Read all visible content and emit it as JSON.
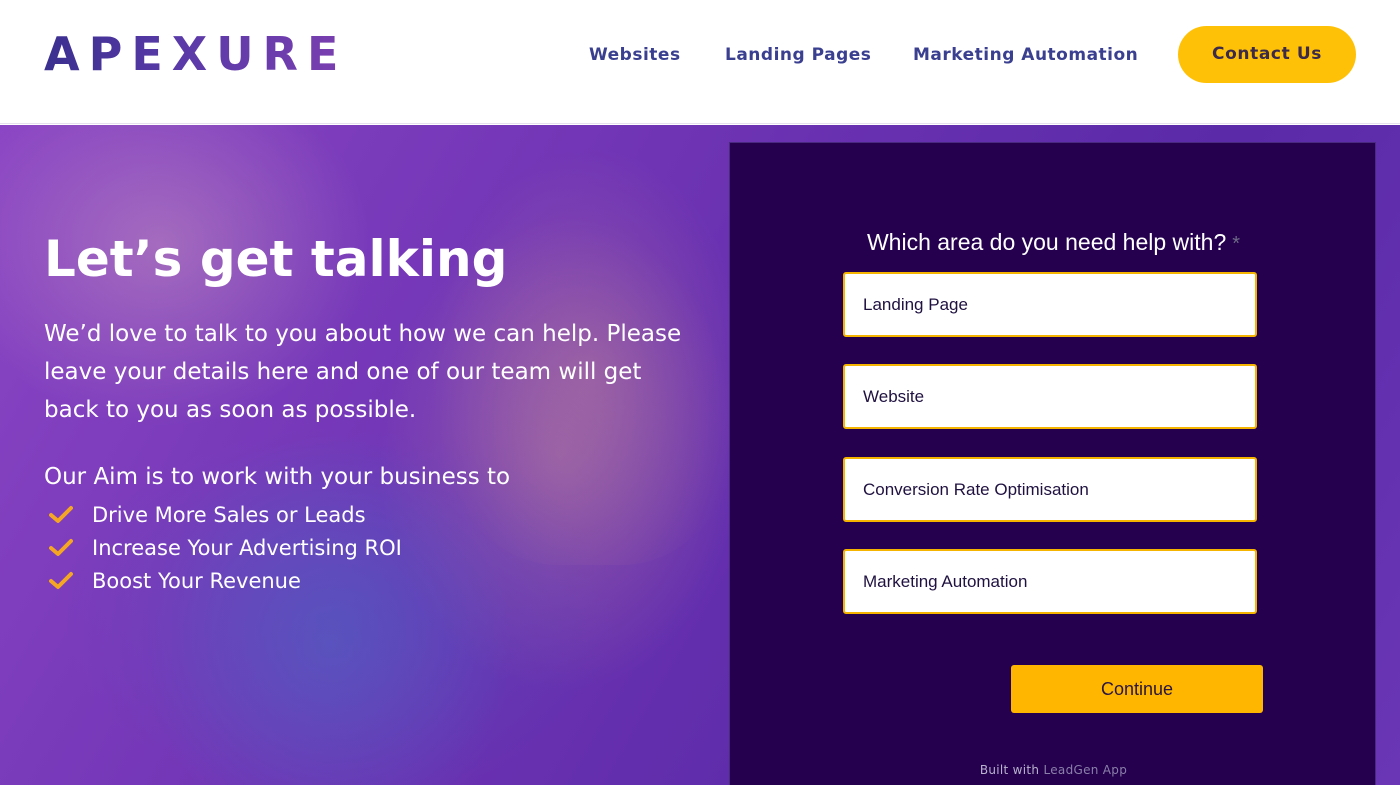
{
  "header": {
    "logo": "APEXURE",
    "nav": [
      "Websites",
      "Landing Pages",
      "Marketing Automation"
    ],
    "contact_label": "Contact Us"
  },
  "hero": {
    "headline": "Let’s get talking",
    "intro": "We’d love to talk to you about how we can help. Please leave your details here and one of our team will get back to you as soon as possible.",
    "aim": "Our Aim is to work with your business to",
    "benefits": [
      "Drive More Sales or Leads",
      "Increase Your Advertising ROI",
      "Boost Your Revenue"
    ]
  },
  "form": {
    "question": "Which area do you need help with?",
    "required_mark": "*",
    "options": [
      "Landing Page",
      "Website",
      "Conversion Rate Optimisation",
      "Marketing Automation"
    ],
    "continue_label": "Continue",
    "built_with": "Built with",
    "built_link": "LeadGen App"
  },
  "colors": {
    "brand_navy": "#3a3f8f",
    "accent_yellow": "#ffc107",
    "panel_bg": "#24004f",
    "hero_purple": "#6d33b3",
    "check_orange": "#f5a623"
  },
  "icons": {
    "benefit_icon": "check-icon"
  }
}
